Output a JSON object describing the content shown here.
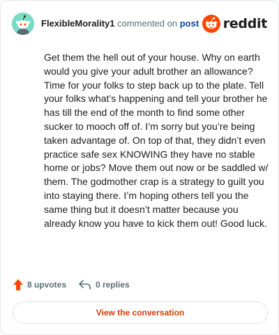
{
  "header": {
    "username": "FlexibleMorality1",
    "action_text": "commented on",
    "post_link": "post",
    "brand": "reddit"
  },
  "comment": {
    "body": "Get them the hell out of your house. Why on earth would you give your adult brother an allowance? Time for your folks to step back up to the plate. Tell your folks what’s happening and tell your brother he has till the end of the month to find some other sucker to mooch off of. I’m sorry but you’re being taken advantage of. On top of that, they didn’t even practice safe sex KNOWING they have no stable home or jobs? Move them out now or be saddled w/ them. The godmother crap is a strategy to guilt you into staying there. I’m hoping others tell you the same thing but it doesn’t matter because you already know you have to kick them out! Good luck."
  },
  "footer": {
    "upvotes": "8 upvotes",
    "replies": "0 replies"
  },
  "actions": {
    "view_conversation": "View the conversation"
  },
  "colors": {
    "accent": "#d93a00",
    "upvote": "#ff4500",
    "avatar_bg": "#7adbc5",
    "link": "#0a449b"
  }
}
